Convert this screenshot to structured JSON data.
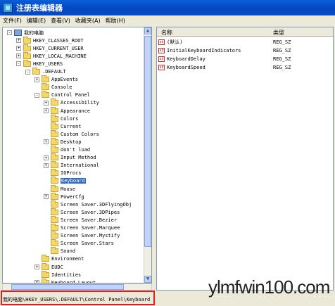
{
  "window": {
    "title": "注册表编辑器"
  },
  "menu": [
    "文件(F)",
    "编辑(E)",
    "查看(V)",
    "收藏夹(A)",
    "帮助(H)"
  ],
  "tree": [
    {
      "label": "我的电脑",
      "level": 0,
      "expander": "-",
      "icon": "computer"
    },
    {
      "label": "HKEY_CLASSES_ROOT",
      "level": 1,
      "expander": "+",
      "icon": "folder"
    },
    {
      "label": "HKEY_CURRENT_USER",
      "level": 1,
      "expander": "+",
      "icon": "folder"
    },
    {
      "label": "HKEY_LOCAL_MACHINE",
      "level": 1,
      "expander": "+",
      "icon": "folder"
    },
    {
      "label": "HKEY_USERS",
      "level": 1,
      "expander": "-",
      "icon": "folder"
    },
    {
      "label": ".DEFAULT",
      "level": 2,
      "expander": "-",
      "icon": "folder"
    },
    {
      "label": "AppEvents",
      "level": 3,
      "expander": "+",
      "icon": "folder"
    },
    {
      "label": "Console",
      "level": 3,
      "expander": "",
      "icon": "folder"
    },
    {
      "label": "Control Panel",
      "level": 3,
      "expander": "-",
      "icon": "folder"
    },
    {
      "label": "Accessibility",
      "level": 4,
      "expander": "+",
      "icon": "folder"
    },
    {
      "label": "Appearance",
      "level": 4,
      "expander": "+",
      "icon": "folder"
    },
    {
      "label": "Colors",
      "level": 4,
      "expander": "",
      "icon": "folder"
    },
    {
      "label": "Current",
      "level": 4,
      "expander": "",
      "icon": "folder"
    },
    {
      "label": "Custom Colors",
      "level": 4,
      "expander": "",
      "icon": "folder"
    },
    {
      "label": "Desktop",
      "level": 4,
      "expander": "+",
      "icon": "folder"
    },
    {
      "label": "don't load",
      "level": 4,
      "expander": "",
      "icon": "folder"
    },
    {
      "label": "Input Method",
      "level": 4,
      "expander": "+",
      "icon": "folder"
    },
    {
      "label": "International",
      "level": 4,
      "expander": "+",
      "icon": "folder"
    },
    {
      "label": "IOProcs",
      "level": 4,
      "expander": "",
      "icon": "folder"
    },
    {
      "label": "Keyboard",
      "level": 4,
      "expander": "",
      "icon": "folder",
      "selected": true
    },
    {
      "label": "Mouse",
      "level": 4,
      "expander": "",
      "icon": "folder"
    },
    {
      "label": "PowerCfg",
      "level": 4,
      "expander": "+",
      "icon": "folder"
    },
    {
      "label": "Screen Saver.3DFlyingObj",
      "level": 4,
      "expander": "",
      "icon": "folder"
    },
    {
      "label": "Screen Saver.3DPipes",
      "level": 4,
      "expander": "",
      "icon": "folder"
    },
    {
      "label": "Screen Saver.Bezier",
      "level": 4,
      "expander": "",
      "icon": "folder"
    },
    {
      "label": "Screen Saver.Marquee",
      "level": 4,
      "expander": "",
      "icon": "folder"
    },
    {
      "label": "Screen Saver.Mystify",
      "level": 4,
      "expander": "",
      "icon": "folder"
    },
    {
      "label": "Screen Saver.Stars",
      "level": 4,
      "expander": "",
      "icon": "folder"
    },
    {
      "label": "Sound",
      "level": 4,
      "expander": "",
      "icon": "folder"
    },
    {
      "label": "Environment",
      "level": 3,
      "expander": "",
      "icon": "folder"
    },
    {
      "label": "EUDC",
      "level": 3,
      "expander": "+",
      "icon": "folder"
    },
    {
      "label": "Identities",
      "level": 3,
      "expander": "",
      "icon": "folder"
    },
    {
      "label": "Keyboard Layout",
      "level": 3,
      "expander": "+",
      "icon": "folder"
    }
  ],
  "list": {
    "headers": {
      "name": "名称",
      "type": "类型"
    },
    "rows": [
      {
        "name": "(默认)",
        "type": "REG_SZ"
      },
      {
        "name": "InitialKeyboardIndicators",
        "type": "REG_SZ"
      },
      {
        "name": "KeyboardDelay",
        "type": "REG_SZ"
      },
      {
        "name": "KeyboardSpeed",
        "type": "REG_SZ"
      }
    ]
  },
  "status": {
    "path": "我的电脑\\HKEY_USERS\\.DEFAULT\\Control Panel\\Keyboard"
  },
  "watermark": "ylmfwin100.com",
  "colors": {
    "titlebar": "#0347c3",
    "selection": "#316ac5",
    "highlight_box": "#e02020"
  }
}
